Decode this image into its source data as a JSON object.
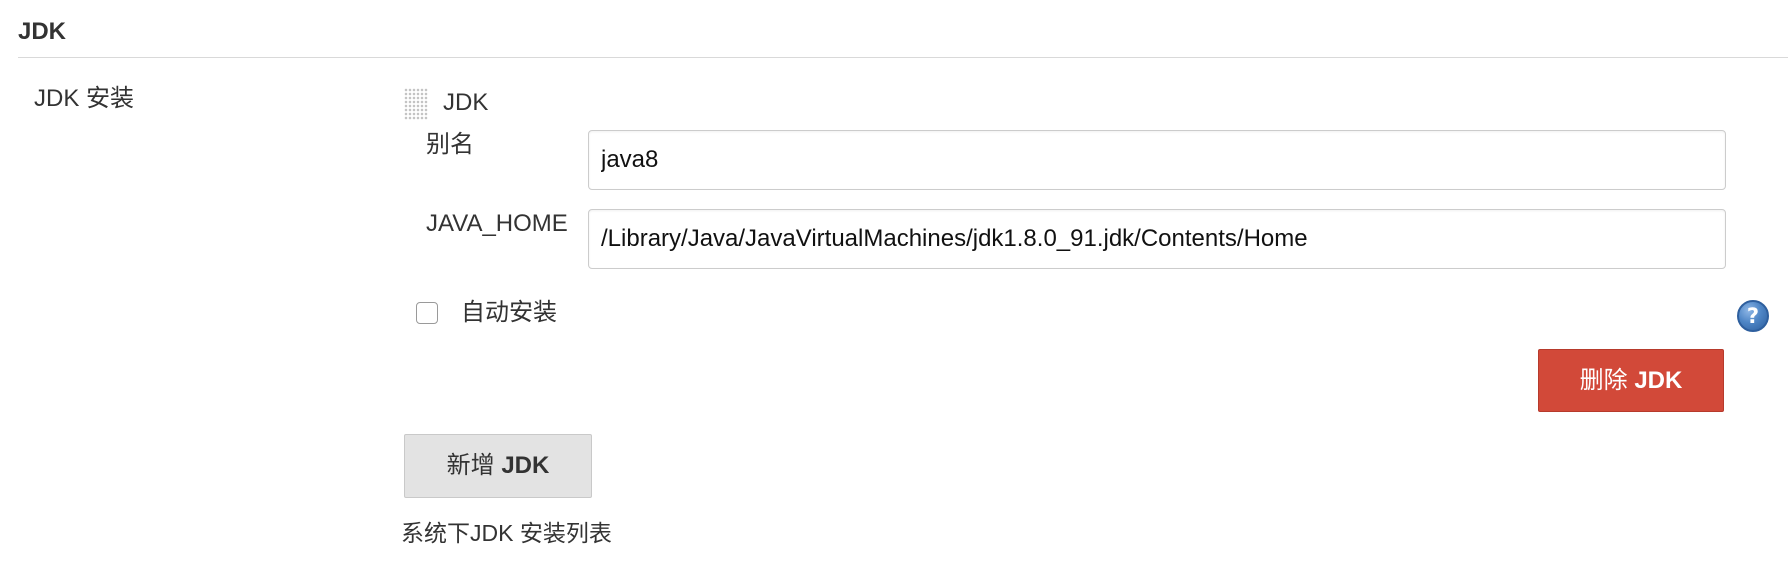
{
  "section": {
    "title": "JDK"
  },
  "row": {
    "label": "JDK 安装"
  },
  "jdk_block": {
    "title": "JDK",
    "fields": {
      "alias_label": "别名",
      "alias_value": "java8",
      "java_home_label": "JAVA_HOME",
      "java_home_value": "/Library/Java/JavaVirtualMachines/jdk1.8.0_91.jdk/Contents/Home"
    },
    "auto_install": {
      "label": "自动安装",
      "checked": false
    },
    "help_glyph": "?",
    "delete_button": {
      "prefix": "删除 ",
      "suffix": "JDK"
    }
  },
  "add_button": {
    "prefix": "新增 ",
    "suffix": "JDK"
  },
  "footer": {
    "description": "系统下JDK 安装列表"
  },
  "colors": {
    "delete_button_bg": "#d24939",
    "add_button_bg": "#e3e3e3",
    "help_icon": "#4f86c6"
  },
  "icons": {
    "drag": "drag-handle-icon",
    "help": "help-icon"
  }
}
